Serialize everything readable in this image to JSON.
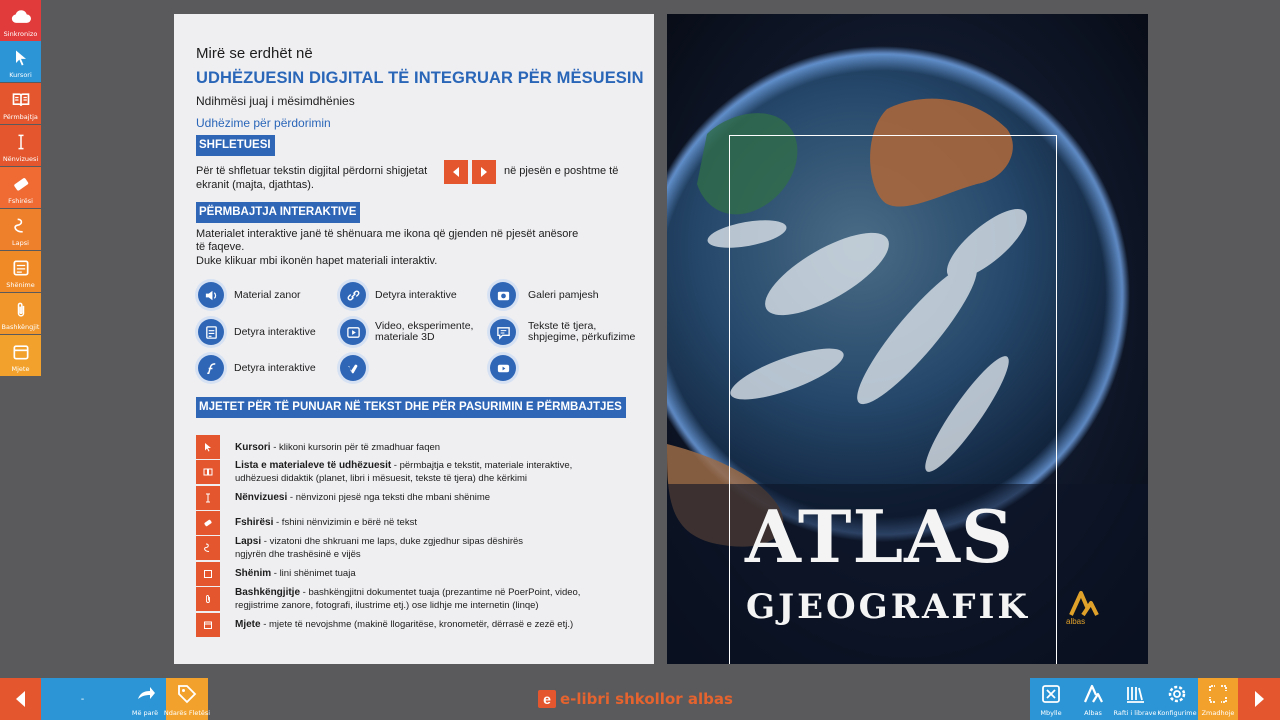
{
  "sidebar": {
    "items": [
      {
        "label": "Sinkronizo",
        "icon": "cloud-icon",
        "color": "#e23b3b"
      },
      {
        "label": "Kursori",
        "icon": "cursor-icon",
        "color": "#2c95d6"
      },
      {
        "label": "Përmbajtja",
        "icon": "book-icon",
        "color": "#e4572e"
      },
      {
        "label": "Nënvizuesi",
        "icon": "text-cursor-icon",
        "color": "#e4572e"
      },
      {
        "label": "Fshirësi",
        "icon": "eraser-icon",
        "color": "#ef6b33"
      },
      {
        "label": "Lapsi",
        "icon": "pencil-scribble-icon",
        "color": "#ee7f2b"
      },
      {
        "label": "Shënime",
        "icon": "note-icon",
        "color": "#ef8a27"
      },
      {
        "label": "Bashkëngjit",
        "icon": "paperclip-icon",
        "color": "#f0962a"
      },
      {
        "label": "Mjete",
        "icon": "tools-icon",
        "color": "#f2a22c"
      }
    ]
  },
  "left_page": {
    "welcome": "Mirë se erdhët në",
    "title": "UDHËZUESIN DIGJITAL TË INTEGRUAR PËR MËSUESIN",
    "subtitle": "Ndihmësi juaj i mësimdhënies",
    "instructions_heading": "Udhëzime për përdorimin",
    "section1": {
      "heading": "SHFLETUESI",
      "text_before": "Për të shfletuar tekstin digjital përdorni shigjetat",
      "text_after_line1": "në pjesën e poshtme të",
      "text_after_line2": "ekranit (majta, djathtas)."
    },
    "section2": {
      "heading": "PËRMBAJTJA INTERAKTIVE",
      "line1": "Materialet interaktive janë të shënuara me ikona që gjenden në pjesët anësore",
      "line2": "të faqeve.",
      "line3": "Duke klikuar mbi ikonën hapet materiali interaktiv.",
      "icons": [
        {
          "icon": "speaker-icon",
          "label": "Material zanor"
        },
        {
          "icon": "link-icon",
          "label": "Detyra interaktive"
        },
        {
          "icon": "camera-icon",
          "label": "Galeri pamjesh"
        },
        {
          "icon": "form-icon",
          "label": "Detyra interaktive"
        },
        {
          "icon": "video-icon",
          "label_line1": "Video, eksperimente,",
          "label_line2": "materiale 3D"
        },
        {
          "icon": "chat-icon",
          "label_line1": "Tekste të tjera,",
          "label_line2": "shpjegime, përkufizime"
        },
        {
          "icon": "flash-icon",
          "label": "Detyra interaktive"
        },
        {
          "icon": "vimeo-icon",
          "label": ""
        },
        {
          "icon": "youtube-icon",
          "label": ""
        }
      ]
    },
    "section3": {
      "heading": "MJETET PËR TË PUNUAR NË TEKST DHE PËR PASURIMIN E PËRMBAJTJES",
      "tools": [
        {
          "icon": "cursor-icon",
          "name": "Kursori",
          "desc1": " - klikoni kursorin për të zmadhuar faqen",
          "desc2": ""
        },
        {
          "icon": "book-icon",
          "name": "Lista e materialeve të udhëzuesit",
          "desc1": " - përmbajtja e tekstit, materiale interaktive,",
          "desc2": "udhëzuesi didaktik (planet, libri i mësuesit, tekste të tjera) dhe kërkimi"
        },
        {
          "icon": "text-cursor-icon",
          "name": "Nënvizuesi",
          "desc1": " - nënvizoni pjesë nga teksti dhe mbani shënime",
          "desc2": ""
        },
        {
          "icon": "eraser-icon",
          "name": "Fshirësi",
          "desc1": " - fshini nënvizimin e bërë në tekst",
          "desc2": ""
        },
        {
          "icon": "pencil-scribble-icon",
          "name": "Lapsi",
          "desc1": " - vizatoni dhe shkruani me laps, duke zgjedhur sipas dëshirës",
          "desc2": "ngjyrën dhe trashësinë e vijës"
        },
        {
          "icon": "note-icon",
          "name": "Shënim",
          "desc1": " - lini shënimet tuaja",
          "desc2": ""
        },
        {
          "icon": "paperclip-icon",
          "name": "Bashkëngjitje",
          "desc1": " - bashkëngjitni dokumentet tuaja (prezantime në PoerPoint, video,",
          "desc2": "regjistrime zanore, fotografi, ilustrime etj.) ose lidhje me internetin (linqe)"
        },
        {
          "icon": "tools-icon",
          "name": "Mjete",
          "desc1": " - mjete të nevojshme (makinë llogaritëse, kronometër, dërrasë e zezë etj.)",
          "desc2": ""
        }
      ]
    }
  },
  "right_page": {
    "title": "ATLAS",
    "subtitle": "GJEOGRAFIK",
    "publisher": "albas"
  },
  "bottombar": {
    "page_indicator": "-",
    "buttons_left": [
      {
        "label": "Më parë",
        "icon": "back-arrow-icon",
        "color": "#2c95d6"
      },
      {
        "label": "Ndarës Fletësi",
        "icon": "tag-icon",
        "color": "#f2a22c"
      }
    ],
    "brand": "e-libri shkollor albas",
    "brand_mark": "e",
    "buttons_right": [
      {
        "label": "Mbylle",
        "icon": "close-box-icon",
        "color": "#2c95d6"
      },
      {
        "label": "Albas",
        "icon": "albas-logo-icon",
        "color": "#2c95d6"
      },
      {
        "label": "Rafti i librave",
        "icon": "bookshelf-icon",
        "color": "#2c95d6"
      },
      {
        "label": "Konfigurime",
        "icon": "gear-icon",
        "color": "#2c95d6"
      },
      {
        "label": "Zmadhoje",
        "icon": "fullscreen-icon",
        "color": "#f2a22c"
      }
    ]
  },
  "colors": {
    "orange": "#e4572e",
    "blue": "#2f66b6",
    "light_blue": "#2c95d6"
  }
}
